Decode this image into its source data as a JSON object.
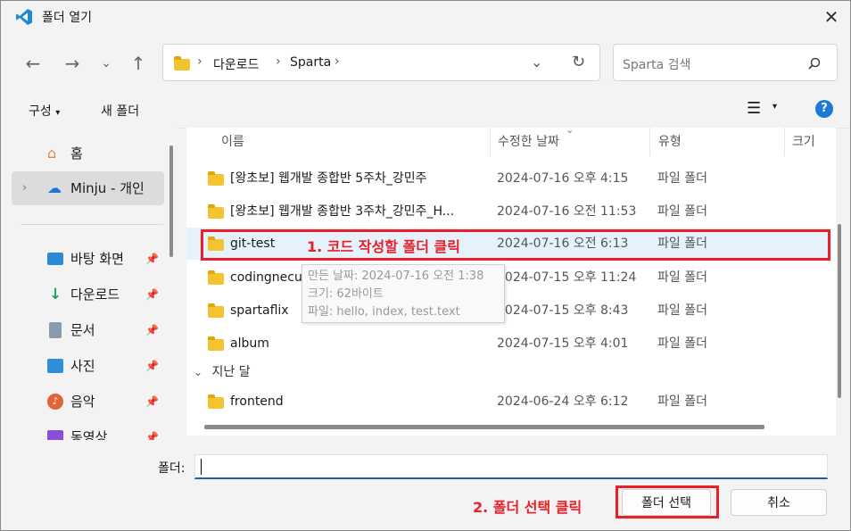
{
  "window": {
    "title": "폴더 열기"
  },
  "address": {
    "crumbs": [
      "다운로드",
      "Sparta"
    ]
  },
  "search": {
    "placeholder": "Sparta 검색"
  },
  "toolbar": {
    "organize": "구성",
    "new_folder": "새 폴더"
  },
  "sidebar": {
    "home": "홈",
    "onedrive": "Minju - 개인",
    "quick": [
      {
        "label": "바탕 화면",
        "icon": "desktop-icon"
      },
      {
        "label": "다운로드",
        "icon": "download-icon"
      },
      {
        "label": "문서",
        "icon": "document-icon"
      },
      {
        "label": "사진",
        "icon": "pictures-icon"
      },
      {
        "label": "음악",
        "icon": "music-icon"
      },
      {
        "label": "동영상",
        "icon": "video-icon"
      }
    ]
  },
  "columns": {
    "name": "이름",
    "date": "수정한 날짜",
    "type": "유형",
    "size": "크기"
  },
  "files": [
    {
      "name": "[왕초보] 웹개발 종합반 5주차_강민주",
      "date": "2024-07-16 오후 4:15",
      "type": "파일 폴더"
    },
    {
      "name": "[왕초보] 웹개발 종합반 3주차_강민주_H...",
      "date": "2024-07-16 오전 11:53",
      "type": "파일 폴더"
    },
    {
      "name": "git-test",
      "date": "2024-07-16 오전 6:13",
      "type": "파일 폴더"
    },
    {
      "name": "codingnecut",
      "date": "2024-07-15 오후 11:24",
      "type": "파일 폴더"
    },
    {
      "name": "spartaflix",
      "date": "2024-07-15 오후 8:43",
      "type": "파일 폴더"
    },
    {
      "name": "album",
      "date": "2024-07-15 오후 4:01",
      "type": "파일 폴더"
    }
  ],
  "group_last_month": "지난 달",
  "files_last_month": [
    {
      "name": "frontend",
      "date": "2024-06-24 오후 6:12",
      "type": "파일 폴더"
    }
  ],
  "tooltip": {
    "line1": "만든 날짜: 2024-07-16 오전 1:38",
    "line2": "크기: 62바이트",
    "line3": "파일: hello, index, test.text"
  },
  "footer": {
    "folder_label": "폴더:",
    "folder_value": "",
    "select_button": "폴더 선택",
    "cancel_button": "취소"
  },
  "annotations": {
    "step1": "1. 코드 작성할 폴더 클릭",
    "step2": "2. 폴더 선택 클릭"
  },
  "colors": {
    "annotation": "#e8202a",
    "selected_row": "#e5f1fb",
    "help": "#1e7ad6"
  }
}
